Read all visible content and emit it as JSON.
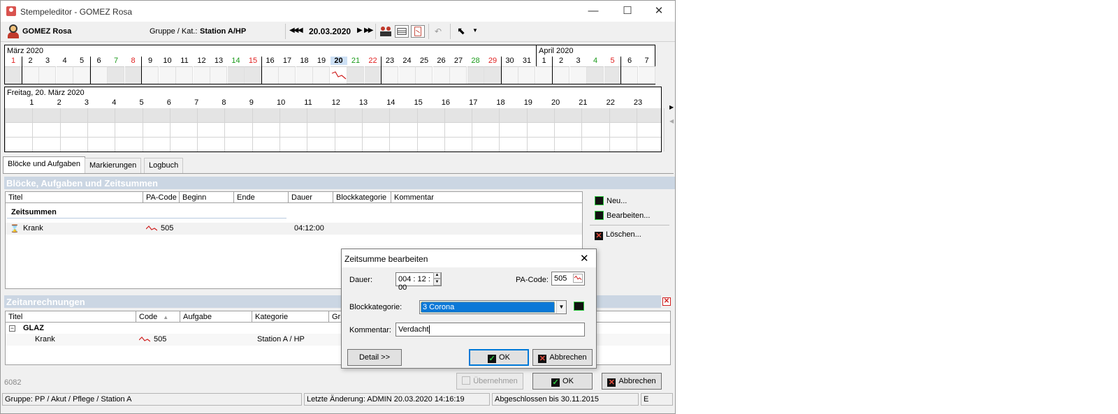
{
  "window": {
    "title": "Stempeleditor - GOMEZ Rosa",
    "minimize": "—",
    "maximize": "☐",
    "close": "✕"
  },
  "header": {
    "person": "GOMEZ Rosa",
    "group_label": "Gruppe / Kat.:",
    "group_value": "Station A/HP",
    "date": "20.03.2020",
    "nav_prev_all": "⏮",
    "nav_prev": "◀",
    "nav_next": "▶",
    "nav_next_all": "⏭"
  },
  "month_strip": {
    "month1": "März 2020",
    "month2": "April 2020",
    "days": [
      {
        "d": "1",
        "c": "red"
      },
      {
        "d": "2",
        "c": "black"
      },
      {
        "d": "3",
        "c": "black"
      },
      {
        "d": "4",
        "c": "black"
      },
      {
        "d": "5",
        "c": "black"
      },
      {
        "d": "6",
        "c": "black"
      },
      {
        "d": "7",
        "c": "green"
      },
      {
        "d": "8",
        "c": "red"
      },
      {
        "d": "9",
        "c": "black"
      },
      {
        "d": "10",
        "c": "black"
      },
      {
        "d": "11",
        "c": "black"
      },
      {
        "d": "12",
        "c": "black"
      },
      {
        "d": "13",
        "c": "black"
      },
      {
        "d": "14",
        "c": "green"
      },
      {
        "d": "15",
        "c": "red"
      },
      {
        "d": "16",
        "c": "black"
      },
      {
        "d": "17",
        "c": "black"
      },
      {
        "d": "18",
        "c": "black"
      },
      {
        "d": "19",
        "c": "black"
      },
      {
        "d": "20",
        "c": "black"
      },
      {
        "d": "21",
        "c": "green"
      },
      {
        "d": "22",
        "c": "red"
      },
      {
        "d": "23",
        "c": "black"
      },
      {
        "d": "24",
        "c": "black"
      },
      {
        "d": "25",
        "c": "black"
      },
      {
        "d": "26",
        "c": "black"
      },
      {
        "d": "27",
        "c": "black"
      },
      {
        "d": "28",
        "c": "green"
      },
      {
        "d": "29",
        "c": "red"
      },
      {
        "d": "30",
        "c": "black"
      },
      {
        "d": "31",
        "c": "black"
      },
      {
        "d": "1",
        "c": "black"
      },
      {
        "d": "2",
        "c": "black"
      },
      {
        "d": "3",
        "c": "black"
      },
      {
        "d": "4",
        "c": "green"
      },
      {
        "d": "5",
        "c": "red"
      },
      {
        "d": "6",
        "c": "black"
      },
      {
        "d": "7",
        "c": "black"
      }
    ],
    "selected_index": 19
  },
  "day_view": {
    "title": "Freitag, 20. März 2020",
    "hours": [
      "1",
      "2",
      "3",
      "4",
      "5",
      "6",
      "7",
      "8",
      "9",
      "10",
      "11",
      "12",
      "13",
      "14",
      "15",
      "16",
      "17",
      "18",
      "19",
      "20",
      "21",
      "22",
      "23"
    ]
  },
  "tabs": [
    "Blöcke und Aufgaben",
    "Markierungen",
    "Logbuch"
  ],
  "blocks": {
    "heading": "Blöcke, Aufgaben und Zeitsummen",
    "columns": [
      "Titel",
      "PA-Code",
      "Beginn",
      "Ende",
      "Dauer",
      "Blockkategorie",
      "Kommentar"
    ],
    "group_title": "Zeitsummen",
    "row": {
      "title": "Krank",
      "pa_code": "505",
      "beginn": "",
      "ende": "",
      "dauer": "04:12:00",
      "kategorie": "",
      "kommentar": ""
    }
  },
  "side_actions": {
    "neu": "Neu...",
    "bearbeiten": "Bearbeiten...",
    "loeschen": "Löschen..."
  },
  "zeitanrechnungen": {
    "heading": "Zeitanrechnungen",
    "columns": [
      "Titel",
      "Code",
      "Aufgabe",
      "Kategorie",
      "Gru"
    ],
    "group": "GLAZ",
    "row": {
      "title": "Krank",
      "code": "505",
      "aufgabe": "",
      "kategorie": "Station A / HP"
    }
  },
  "footer": {
    "id": "6082",
    "uebernehmen": "Übernehmen",
    "ok": "OK",
    "abbrechen": "Abbrechen"
  },
  "statusbar": {
    "gruppe": "Gruppe: PP / Akut / Pflege / Station A",
    "letzte_aenderung": "Letzte Änderung: ADMIN 20.03.2020 14:16:19",
    "abgeschlossen": "Abgeschlossen bis 30.11.2015",
    "mode": "E"
  },
  "dialog": {
    "title": "Zeitsumme bearbeiten",
    "dauer_label": "Dauer:",
    "dauer_value": "004 : 12 : 00",
    "pa_code_label": "PA-Code:",
    "pa_code_value": "505",
    "blockkategorie_label": "Blockkategorie:",
    "blockkategorie_value": "3 Corona",
    "kommentar_label": "Kommentar:",
    "kommentar_value": "Verdacht",
    "detail": "Detail >>",
    "ok": "OK",
    "abbrechen": "Abbrechen"
  },
  "colors": {
    "accent": "#0078d7",
    "section_header": "#cbd6e3",
    "weekend_red": "#e02020",
    "weekend_green": "#1a9a1a",
    "selection": "#0a78d7"
  }
}
